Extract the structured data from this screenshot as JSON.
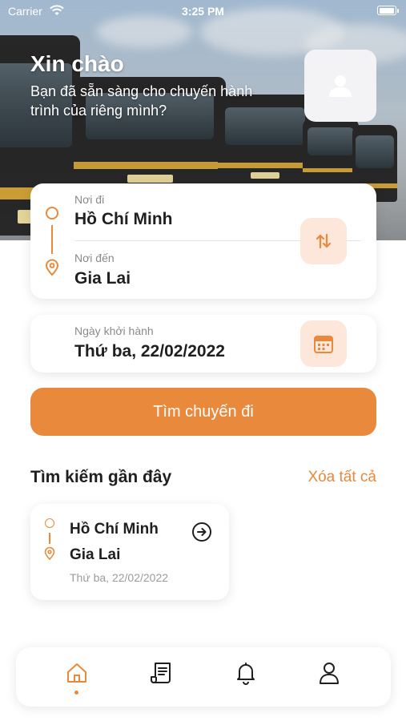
{
  "status_bar": {
    "carrier": "Carrier",
    "time": "3:25 PM"
  },
  "header": {
    "greeting": "Xin chào",
    "subtitle": "Bạn đã sẵn sàng cho chuyến hành trình của riêng mình?"
  },
  "route": {
    "from_label": "Nơi đi",
    "from_value": "Hồ Chí Minh",
    "to_label": "Nơi đến",
    "to_value": "Gia Lai"
  },
  "departure": {
    "label": "Ngày khởi hành",
    "value": "Thứ ba, 22/02/2022"
  },
  "search_button": {
    "label": "Tìm chuyến đi"
  },
  "recent": {
    "title": "Tìm kiếm gần đây",
    "clear_all": "Xóa tất cả",
    "items": [
      {
        "from": "Hồ Chí Minh",
        "to": "Gia Lai",
        "date": "Thứ ba, 22/02/2022"
      }
    ]
  },
  "tabs": [
    {
      "icon": "home-icon",
      "active": true
    },
    {
      "icon": "ticket-icon",
      "active": false
    },
    {
      "icon": "bell-icon",
      "active": false
    },
    {
      "icon": "user-icon",
      "active": false
    }
  ],
  "colors": {
    "accent": "#e8893c",
    "accent_soft": "#fde7da",
    "text": "#1f1f1f",
    "muted": "#8a8a8a"
  }
}
